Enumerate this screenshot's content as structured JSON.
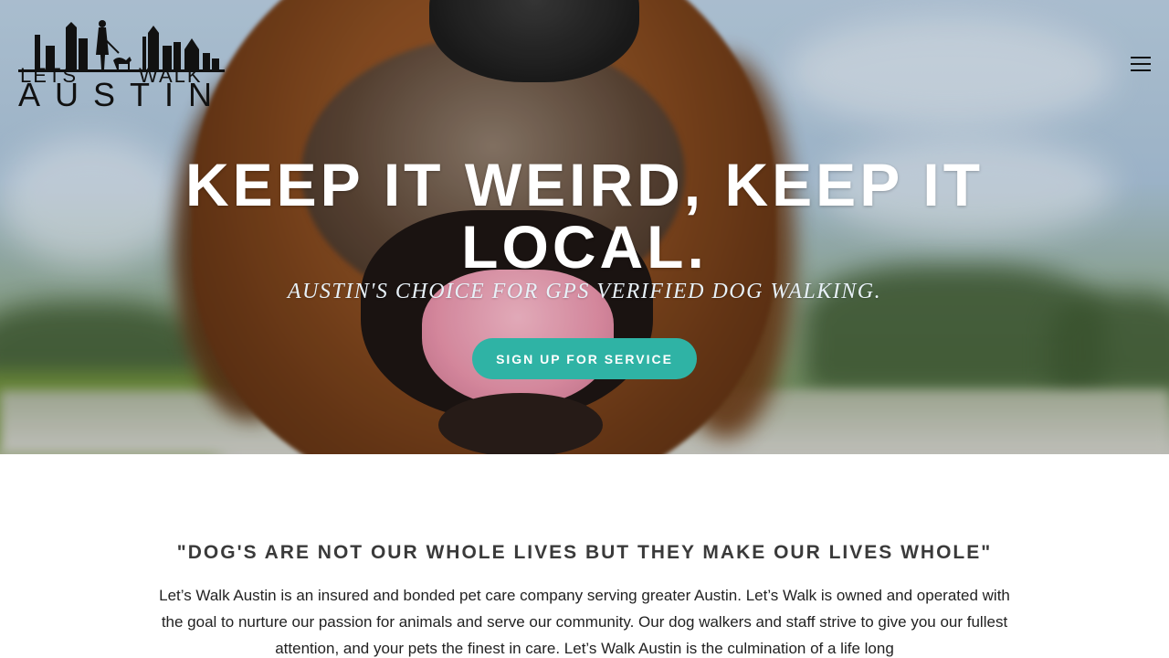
{
  "logo": {
    "line1_left": "LETS",
    "line1_right": "WALK",
    "line2": "AUSTIN"
  },
  "menu": {
    "icon": "hamburger-menu-icon"
  },
  "hero": {
    "title": "KEEP IT WEIRD, KEEP IT LOCAL.",
    "subtitle": "AUSTIN'S CHOICE FOR GPS VERIFIED DOG WALKING.",
    "cta_label": "SIGN UP FOR SERVICE",
    "cta_color": "#2fb3a5"
  },
  "content": {
    "quote": "\"DOG'S ARE NOT OUR WHOLE LIVES BUT THEY MAKE OUR LIVES WHOLE\"",
    "paragraph": "Let’s Walk Austin is an insured and bonded pet care company serving greater Austin. Let’s Walk is owned and operated with the goal to nurture our passion for animals and serve our community. Our dog walkers and staff strive to give you our fullest attention, and your pets the finest in care. Let’s Walk Austin is the culmination of a life long"
  }
}
